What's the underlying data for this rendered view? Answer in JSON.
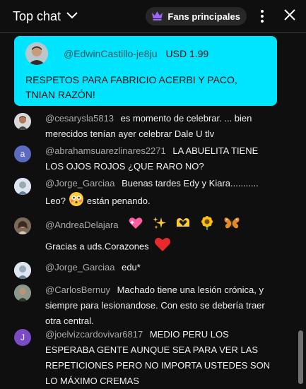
{
  "header": {
    "title": "Top chat",
    "fans_label": "Fans principales"
  },
  "superchat": {
    "author": "@EdwinCastillo-je8ju",
    "amount": "USD 1.99",
    "message": "RESPETOS PARA FABRICIO ACERBI Y PACO, TNIAN RAZÓN!",
    "color": "#00e5ff"
  },
  "messages": [
    {
      "author": "@cesarysla5813",
      "text": "es momento de celebrar. ... bien merecidos tenían ayer celebrar Dale U tlv"
    },
    {
      "author": "@abrahamsuarezlinares2271",
      "text": "LA ABUELITA TIENE LOS OJOS ROJOS ¿QUE RARO NO?",
      "avatar_letter": "a",
      "avatar_color": "#5c6bc0"
    },
    {
      "author": "@Jorge_Garciaa",
      "text_before": "Buenas tardes Edy y Kiara........... Leo?",
      "text_after": "están penando."
    },
    {
      "author": "@AndreaDelajara",
      "text_after": "Gracias a uds.Corazones"
    },
    {
      "author": "@Jorge_Garciaa",
      "text": "edu*"
    },
    {
      "author": "@CarlosBernuy",
      "text": "Machado tiene una lesión crónica, y siempre para lesionandose. Con esto se debería traer otra central."
    },
    {
      "author": "@joelvizcardovivar6817",
      "text": "MEDIO PERU LOS ESPERABA GENTE AUNQUE SEA PARA VER LAS REPETICIONES PERO NO IMPORTA USTEDES SON LO MÁXIMO CREMAS",
      "avatar_letter": "J",
      "avatar_color": "#7b4bc4"
    }
  ]
}
